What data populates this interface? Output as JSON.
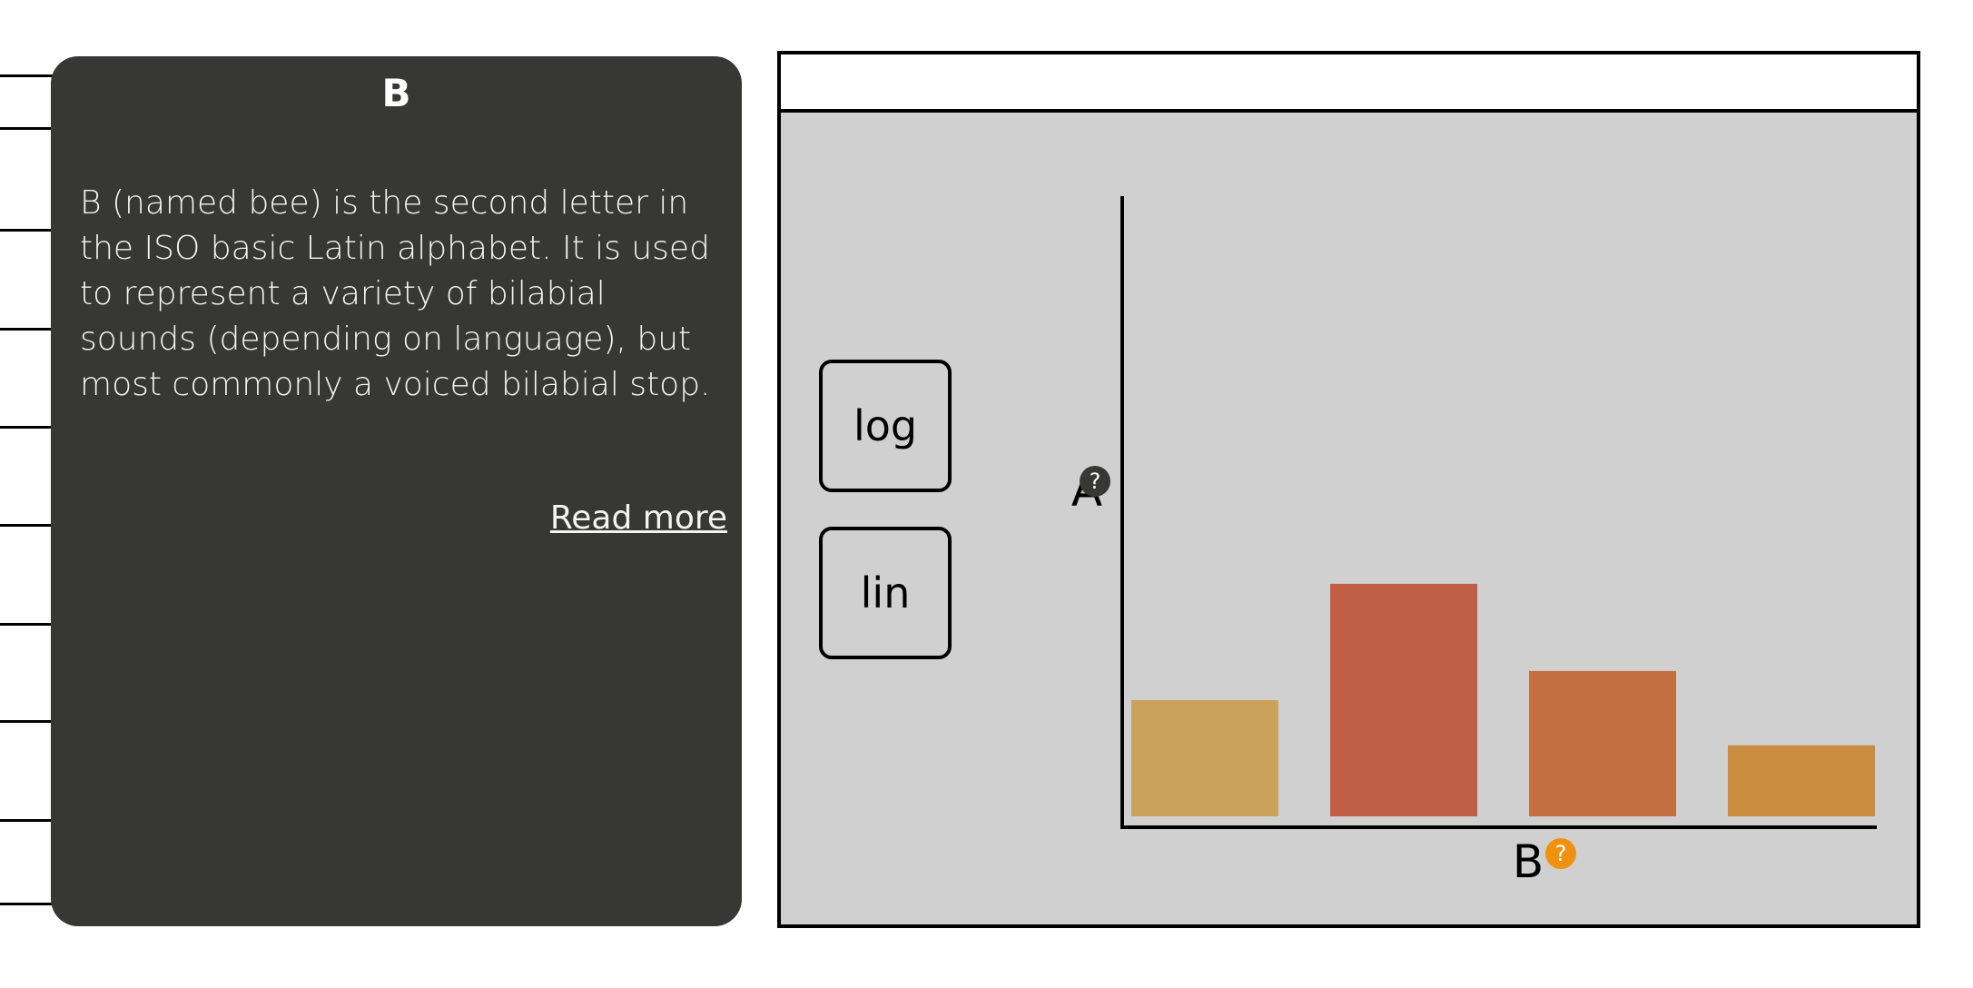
{
  "info_panel": {
    "title": "B",
    "description": "B (named bee) is the second letter in the ISO basic Latin alphabet. It is used to represent a variety of bilabial sounds (depending on language), but most commonly a voiced bilabial stop.",
    "read_more": "Read more"
  },
  "controls": {
    "log_label": "log",
    "lin_label": "lin"
  },
  "help_icon": {
    "glyph": "?",
    "y_color": "#373735",
    "x_color": "#f0920f"
  },
  "chart_data": {
    "type": "bar",
    "xlabel": "B",
    "ylabel": "A",
    "categories": [
      "",
      "",
      "",
      ""
    ],
    "values": [
      18,
      36,
      22.5,
      11
    ],
    "colors": [
      "#cba25c",
      "#c15e47",
      "#c46f41",
      "#c98c40"
    ],
    "ylim": [
      0,
      96
    ],
    "grid": false,
    "legend": "none"
  }
}
